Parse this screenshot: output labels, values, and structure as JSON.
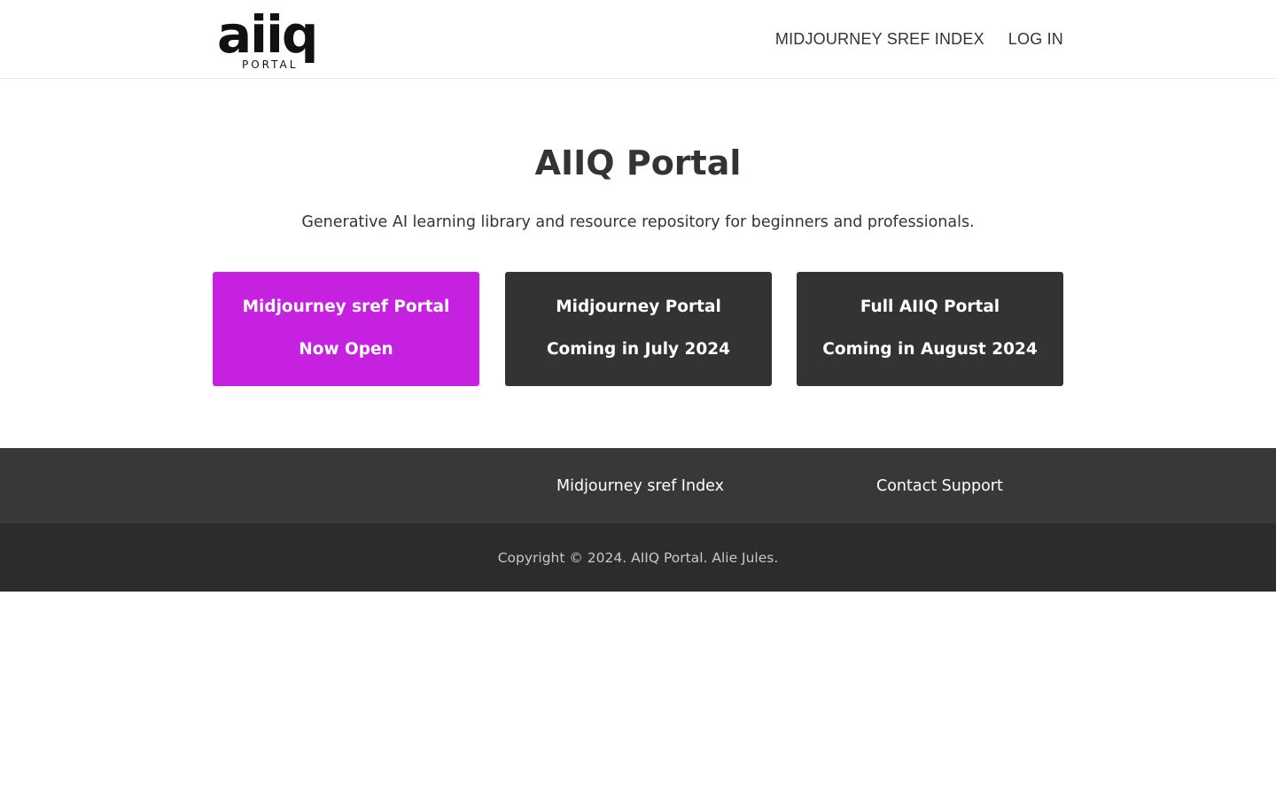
{
  "header": {
    "logo_mark": "aiiq",
    "logo_sub": "PORTAL",
    "nav": [
      {
        "label": "MIDJOURNEY SREF INDEX"
      },
      {
        "label": "LOG IN"
      }
    ]
  },
  "hero": {
    "title": "AIIQ Portal",
    "subtitle": "Generative AI learning library and resource repository for beginners and professionals."
  },
  "cards": [
    {
      "line1": "Midjourney sref Portal",
      "line2": "Now Open",
      "color": "#c620e0"
    },
    {
      "line1": "Midjourney Portal",
      "line2": "Coming in July 2024",
      "color": "#333333"
    },
    {
      "line1": "Full AIIQ Portal",
      "line2": "Coming in August 2024",
      "color": "#333333"
    }
  ],
  "footer": {
    "links": [
      {
        "label": "Midjourney sref Index"
      },
      {
        "label": "Contact Support"
      }
    ],
    "copyright": "Copyright © 2024. AIIQ Portal. Alie Jules."
  },
  "colors": {
    "accent": "#c620e0",
    "dark": "#333333",
    "footer_top": "#383838",
    "footer_bottom": "#2c2c2c"
  }
}
